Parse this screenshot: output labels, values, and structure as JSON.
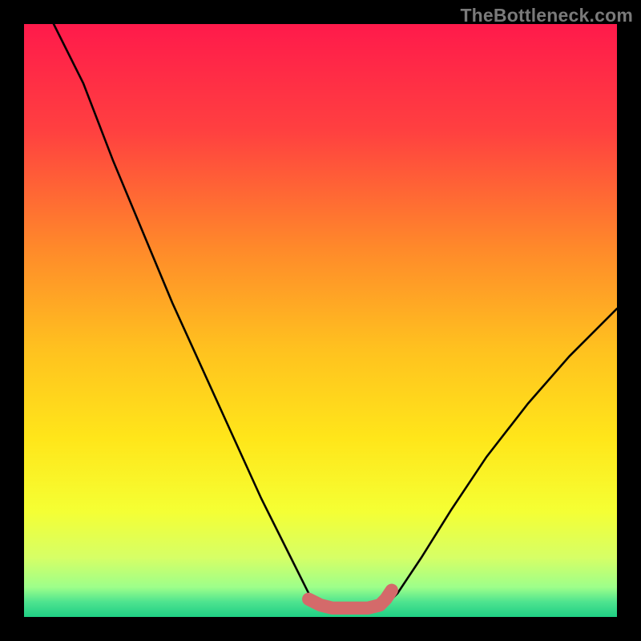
{
  "watermark": "TheBottleneck.com",
  "chart_data": {
    "type": "line",
    "title": "",
    "xlabel": "",
    "ylabel": "",
    "xlim": [
      0,
      100
    ],
    "ylim": [
      0,
      100
    ],
    "series": [
      {
        "name": "left_curve",
        "x": [
          5,
          10,
          15,
          20,
          25,
          30,
          35,
          40,
          45,
          48,
          50
        ],
        "values": [
          100,
          90,
          77,
          65,
          53,
          42,
          31,
          20,
          10,
          4,
          2
        ]
      },
      {
        "name": "right_curve",
        "x": [
          61,
          63,
          67,
          72,
          78,
          85,
          92,
          100
        ],
        "values": [
          2,
          4,
          10,
          18,
          27,
          36,
          44,
          52
        ]
      },
      {
        "name": "optimal_band",
        "x": [
          48,
          50,
          52,
          55,
          58,
          60,
          61,
          62
        ],
        "values": [
          3,
          2,
          1.5,
          1.5,
          1.5,
          2,
          3,
          4.5
        ]
      }
    ],
    "background_gradient": {
      "stops": [
        {
          "offset": 0.0,
          "color": "#ff1a4b"
        },
        {
          "offset": 0.18,
          "color": "#ff4040"
        },
        {
          "offset": 0.38,
          "color": "#ff8a2a"
        },
        {
          "offset": 0.55,
          "color": "#ffc21f"
        },
        {
          "offset": 0.7,
          "color": "#ffe61a"
        },
        {
          "offset": 0.82,
          "color": "#f5ff33"
        },
        {
          "offset": 0.9,
          "color": "#d6ff66"
        },
        {
          "offset": 0.95,
          "color": "#9dff8a"
        },
        {
          "offset": 0.975,
          "color": "#4de38f"
        },
        {
          "offset": 1.0,
          "color": "#1fcf84"
        }
      ]
    },
    "highlight_color": "#d46a6a",
    "curve_color": "#000000"
  }
}
